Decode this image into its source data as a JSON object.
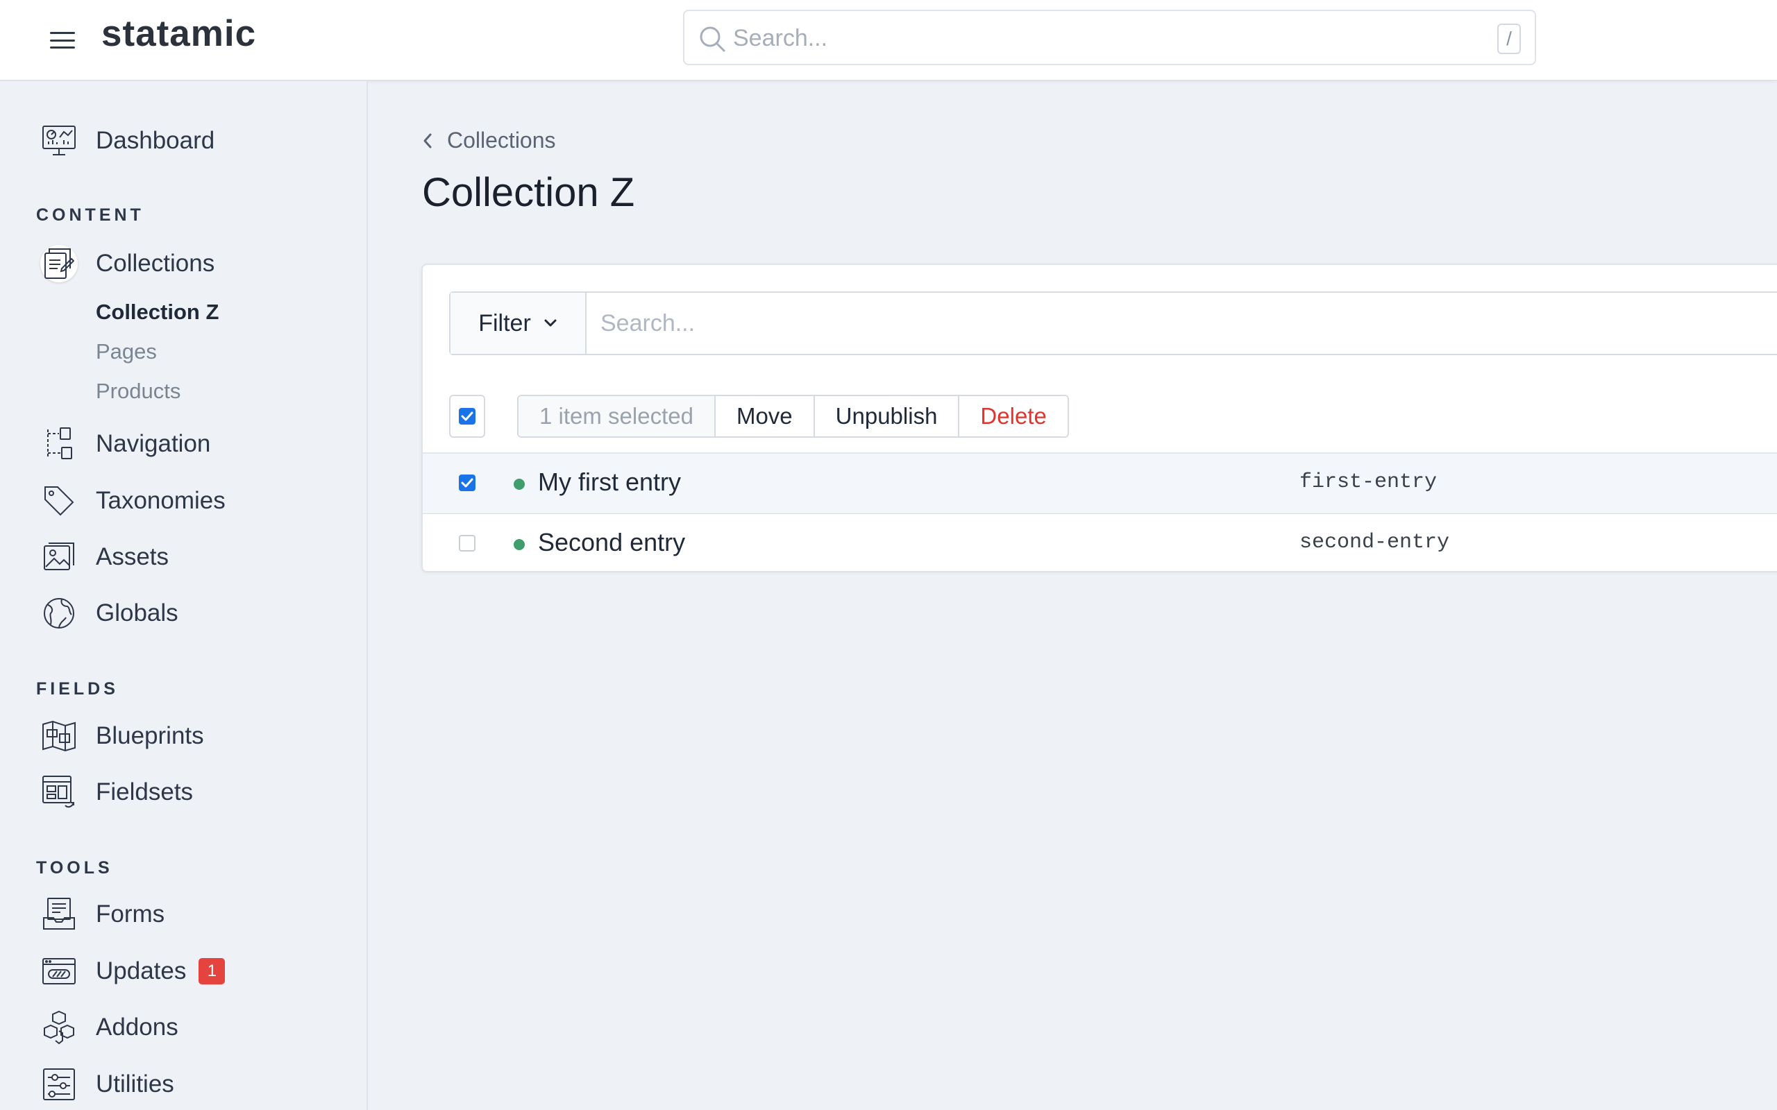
{
  "header": {
    "logo": "statamic",
    "search_placeholder": "Search...",
    "search_shortcut": "/"
  },
  "sidebar": {
    "dashboard": "Dashboard",
    "sections": {
      "content": "CONTENT",
      "fields": "FIELDS",
      "tools": "TOOLS"
    },
    "content_items": [
      "Collections",
      "Navigation",
      "Taxonomies",
      "Assets",
      "Globals"
    ],
    "collections_children": [
      "Collection Z",
      "Pages",
      "Products"
    ],
    "field_items": [
      "Blueprints",
      "Fieldsets"
    ],
    "tool_items": [
      "Forms",
      "Updates",
      "Addons",
      "Utilities"
    ],
    "updates_badge": "1"
  },
  "main": {
    "breadcrumb": "Collections",
    "title": "Collection Z",
    "filter_label": "Filter",
    "filter_placeholder": "Search...",
    "bulk": {
      "selected_text": "1 item selected",
      "move": "Move",
      "unpublish": "Unpublish",
      "delete": "Delete"
    },
    "entries": [
      {
        "title": "My first entry",
        "slug": "first-entry",
        "selected": true,
        "status": "published"
      },
      {
        "title": "Second entry",
        "slug": "second-entry",
        "selected": false,
        "status": "published"
      }
    ]
  },
  "colors": {
    "accent": "#1a73e8",
    "danger": "#e0352e",
    "published": "#3f9e6b",
    "badge": "#e5433e"
  }
}
